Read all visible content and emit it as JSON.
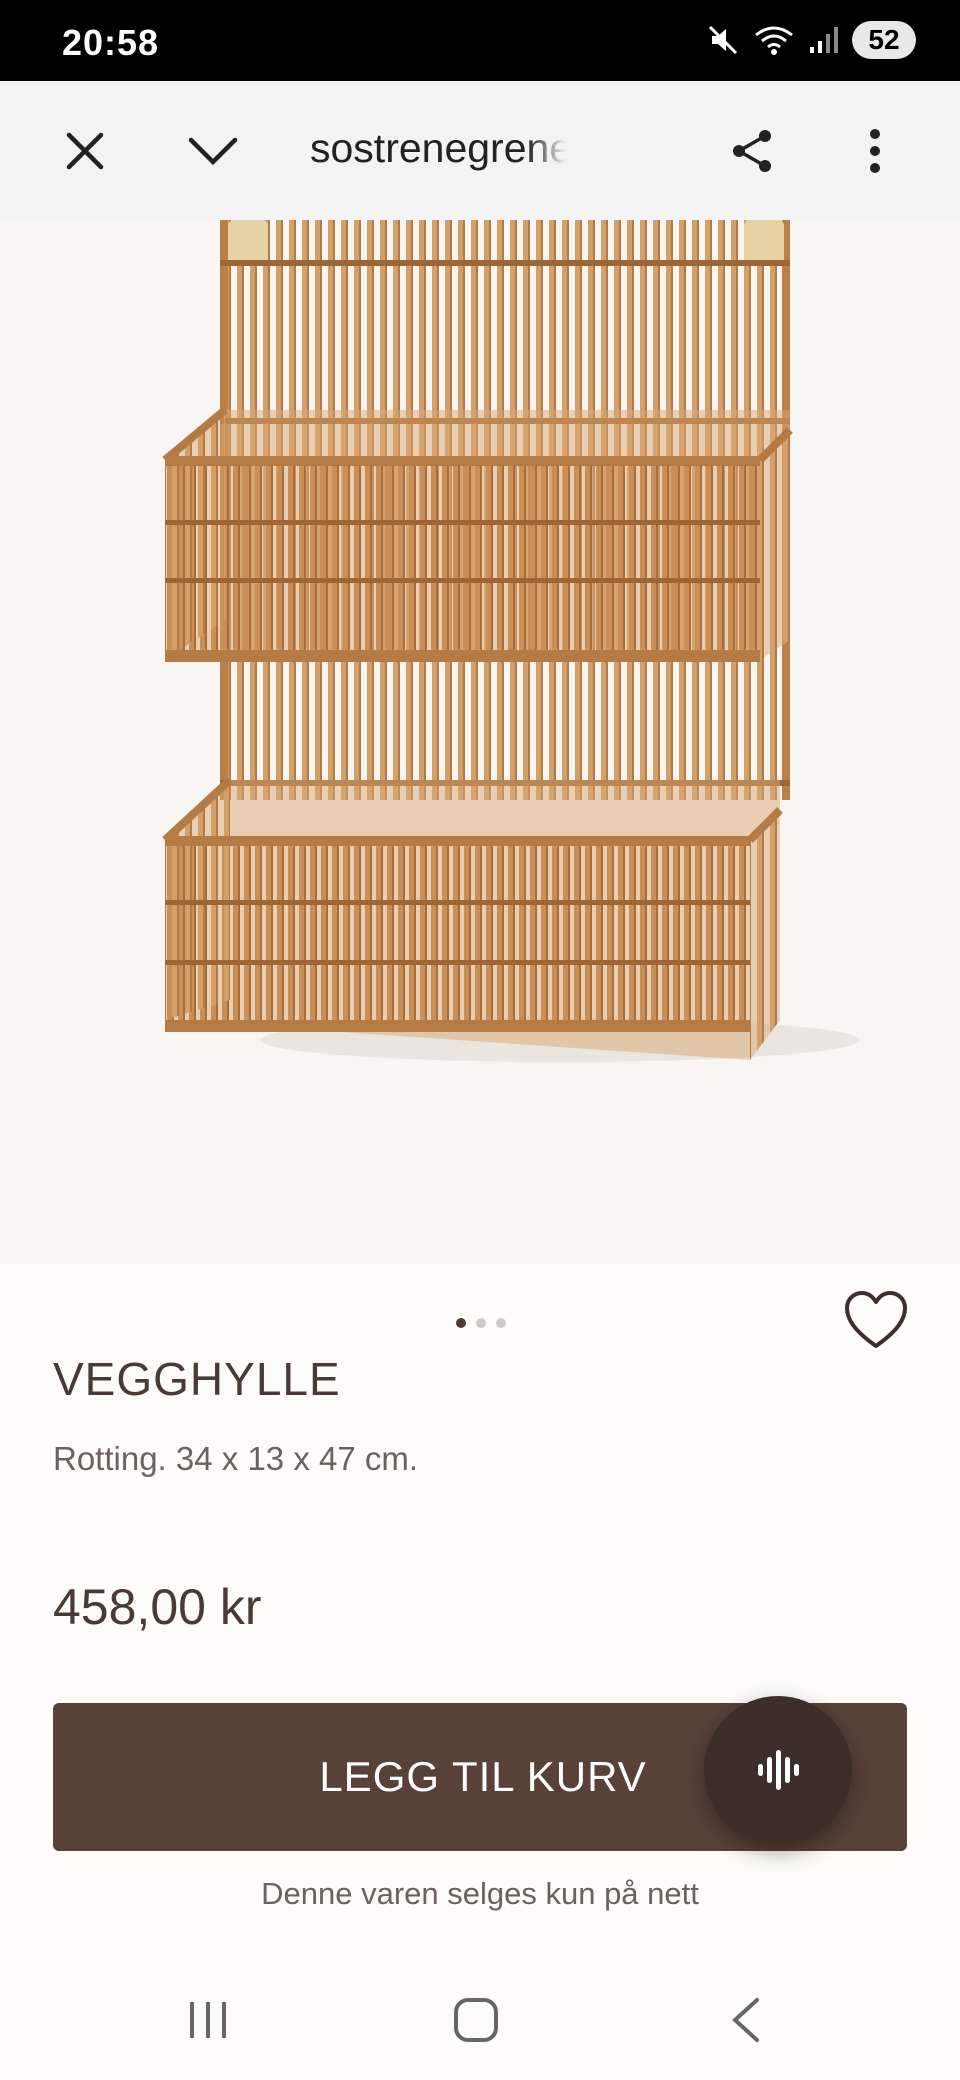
{
  "status_bar": {
    "time": "20:58",
    "battery": "52",
    "icons": [
      "mute-icon",
      "wifi-icon",
      "signal-icon",
      "battery-icon"
    ]
  },
  "browser": {
    "url": "sostrenegrene",
    "icons": [
      "close-icon",
      "chevron-down-icon",
      "share-icon",
      "more-vert-icon"
    ]
  },
  "product": {
    "image_description_icon": "rattan-shelf-image",
    "gallery_total": 3,
    "gallery_active": 1,
    "title": "VEGGHYLLE",
    "description": "Rotting. 34 x 13 x 47 cm.",
    "price": "458,00 kr",
    "add_to_cart_label": "LEGG TIL KURV",
    "note": "Denne varen selges kun på nett"
  },
  "colors": {
    "brand_button": "#574139",
    "text": "#4a3a34",
    "background": "#fdfcf8",
    "rattan": "#c98f57"
  },
  "nav_bar": {
    "icons": [
      "recent-apps-icon",
      "home-icon",
      "back-icon"
    ]
  }
}
